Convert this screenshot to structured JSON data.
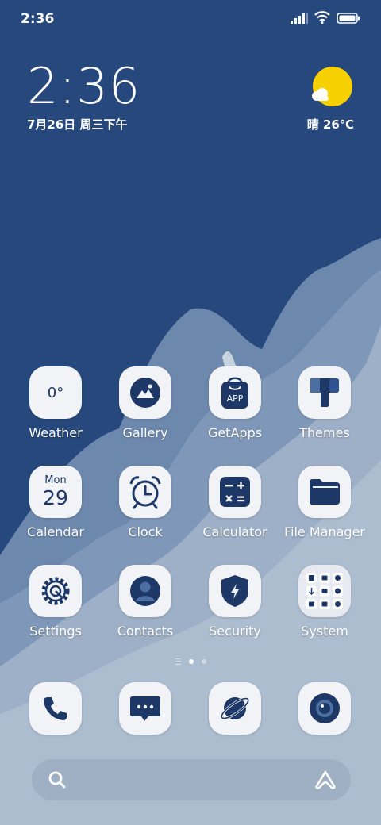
{
  "status_bar": {
    "time": "2:36"
  },
  "clock_widget": {
    "time": "2:36",
    "date": "7月26日 周三下午"
  },
  "weather_widget": {
    "text": "晴 26℃"
  },
  "apps": [
    {
      "label": "Weather",
      "tile_text": "0°",
      "icon": "weather-icon"
    },
    {
      "label": "Gallery",
      "icon": "gallery-icon"
    },
    {
      "label": "GetApps",
      "tile_text": "APP",
      "icon": "getapps-bag-icon"
    },
    {
      "label": "Themes",
      "icon": "themes-icon"
    },
    {
      "label": "Calendar",
      "tile_day": "Mon",
      "tile_num": "29",
      "icon": "calendar-icon"
    },
    {
      "label": "Clock",
      "icon": "alarm-clock-icon"
    },
    {
      "label": "Calculator",
      "icon": "calculator-icon"
    },
    {
      "label": "File Manager",
      "icon": "folder-icon"
    },
    {
      "label": "Settings",
      "icon": "gear-icon"
    },
    {
      "label": "Contacts",
      "icon": "person-icon"
    },
    {
      "label": "Security",
      "icon": "shield-icon"
    },
    {
      "label": "System",
      "icon": "folder-grid-icon"
    }
  ],
  "dock": [
    {
      "icon": "phone-icon"
    },
    {
      "icon": "message-icon"
    },
    {
      "icon": "browser-planet-icon"
    },
    {
      "icon": "camera-icon"
    }
  ],
  "page_indicator": {
    "pages": 2,
    "current": 1
  },
  "colors": {
    "icon_glyph": "#1d3866",
    "tile_bg": "#f1f3f7",
    "sun": "#f7d000",
    "wallpaper_dark": "#27487c"
  }
}
